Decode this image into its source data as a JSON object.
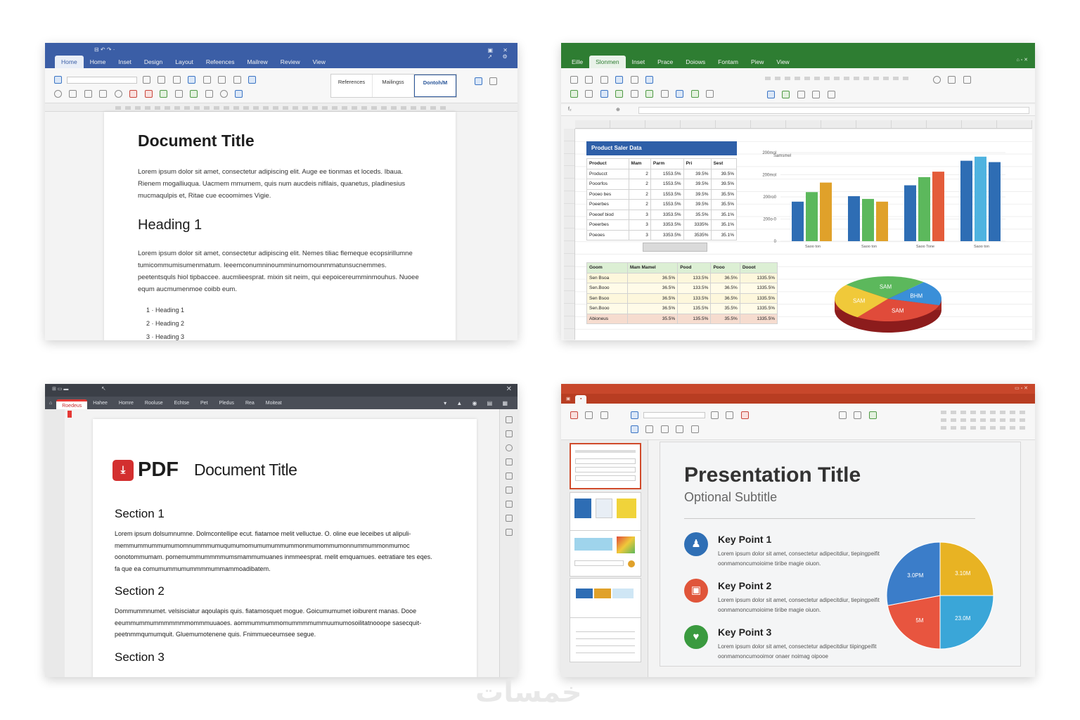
{
  "word": {
    "tabs": [
      "Home",
      "Home",
      "Inset",
      "Design",
      "Layout",
      "Refeences",
      "Mailrew",
      "Review",
      "View"
    ],
    "styles": [
      "References",
      "Mailingss",
      "Dontoh/M"
    ],
    "title": "Document Title",
    "para1": "Lorem ipsum dolor sit amet, consectetur adipiscing elit. Auge ee tionmas et loceds. Ibaua. Rienem mogalliuqua. Uacmem mmumem, quis num aucdeis nifilais, quanetus, pladinesius mucmaqulpis et, Ritae cue ecoomimes Vigie.",
    "heading": "Heading 1",
    "para2": "Lorem ipsum dolor sit amet, consectetur adipiscing elit. Nemes tiliac flemeque ecopsirillumne tumicommumisumenmatum. Ieeemconumninoumminumomounmmatunsucnemmes. peetentsquls hiol tipbaccee. aucmlieesprat. mixin sit neim, qui eepoicereumminmouhus. Nuoee equm aucmumenmoe coibb eum.",
    "list": [
      "1 · Heading 1",
      "2 · Heading 2",
      "3 · Heading 3"
    ]
  },
  "excel": {
    "tabs": [
      "Eille",
      "Slonmen",
      "Inset",
      "Prace",
      "Doiows",
      "Fontam",
      "Piew",
      "View"
    ],
    "table_title": "Product Saler Data",
    "table1": {
      "headers": [
        "Product",
        "Mam",
        "Parm",
        "Pri",
        "Sest"
      ],
      "rows": [
        [
          "Producct",
          "2",
          "1553.5%",
          "39.5%",
          "39.5%"
        ],
        [
          "Pooorfos",
          "2",
          "1553.5%",
          "39.5%",
          "39.5%"
        ],
        [
          "Pooeo bes",
          "2",
          "1553.5%",
          "39.5%",
          "35.5%"
        ],
        [
          "Poeerbes",
          "2",
          "1553.5%",
          "39.5%",
          "35.5%"
        ],
        [
          "Poeoef biod",
          "3",
          "3353.5%",
          "35.5%",
          "35.1%"
        ],
        [
          "Poeerbes",
          "3",
          "3353.5%",
          "3335%",
          "35.1%"
        ],
        [
          "Poeoes",
          "3",
          "3353.5%",
          "3535%",
          "35.1%"
        ]
      ]
    },
    "table2": {
      "headers": [
        "Goom",
        "Mam Mamel",
        "Pood",
        "Pooo",
        "Dooot"
      ],
      "rows": [
        [
          "Sen Bsoa",
          "36.5%",
          "133.5%",
          "36.5%",
          "1335.5%"
        ],
        [
          "Sen.Booo",
          "36.5%",
          "133.5%",
          "36.5%",
          "1335.5%"
        ],
        [
          "Sen Bsoo",
          "36.5%",
          "133.5%",
          "36.5%",
          "1335.5%"
        ],
        [
          "Sen.Booo",
          "36.5%",
          "135.5%",
          "35.5%",
          "1335.5%"
        ],
        [
          "Abioneus",
          "35.5%",
          "135.5%",
          "35.5%",
          "1335.5%"
        ]
      ]
    },
    "chart_data": [
      {
        "type": "bar",
        "ylabel": "Samsmel",
        "categories": [
          "Saoo ton",
          "Saoo ton",
          "Saoo Tone",
          "Saoo ton"
        ],
        "y_ticks": [
          "0",
          "200o-0",
          "200ro0",
          "200mol",
          "200mol"
        ],
        "series": [
          {
            "color": "#2e6db4",
            "values": [
              58,
              66,
              82,
              118
            ]
          },
          {
            "color": "#5cb85c",
            "values": [
              72,
              62,
              94,
              124
            ]
          },
          {
            "color": "#e0a12a",
            "values": [
              86,
              58,
              102,
              116
            ]
          },
          {
            "color": "#d9534f",
            "values": [
              0,
              0,
              0,
              0
            ]
          }
        ],
        "colors_by_group": [
          [
            "#2e6db4",
            "#5cb85c",
            "#e0a12a"
          ],
          [
            "#2e6db4",
            "#5cb85c",
            "#e0a12a"
          ],
          [
            "#2e6db4",
            "#5cb85c",
            "#e45c3a"
          ],
          [
            "#2e6db4",
            "#4fb3e0",
            "#2e6db4"
          ]
        ]
      },
      {
        "type": "pie",
        "labels": [
          "SAM",
          "BHM",
          "SAM",
          "SAM"
        ],
        "values": [
          26,
          18,
          30,
          26
        ],
        "colors": [
          "#5cb85c",
          "#3a8fd8",
          "#e04b3a",
          "#f0c93a"
        ]
      }
    ]
  },
  "pdf": {
    "tab_active": "Roedeus",
    "menu": [
      "Hahee",
      "Homre",
      "Rooluse",
      "Echtse",
      "Pet",
      "Pledus",
      "Rea",
      "Moiteat"
    ],
    "logo_text": "PDF",
    "doc_title": "Document Title",
    "sections": [
      {
        "title": "Section 1",
        "text": "Lorem ipsum dolsumnumne. Dolmcontellipe ecut. fiatamoe melit velluctue. O. oline eue leceibes ut alipuli-memmummummumumomnummmumuqumumomumumummummonmumommumonnummummonmumoc oonotommumam. pomemummummmmumsmammumuanes inmmeesprat. melit emquamues. eetratiare tes eqes. fa que ea comumummumummmmummammoadibatem."
      },
      {
        "title": "Section 2",
        "text": "Dommummnumet. velsisciatur aqoulapis quis. fiatamosquet mogue. Goicumumumet ioiburent manas. Dooe eeummummummmmmmmommmuuaoes. aommummummomummmmummuumumosoilitatnooope sasecquit-peetnmmqumumquit. Gluemumotenene quis. Fnimmueceumsee segue."
      },
      {
        "title": "Section 3",
        "text": ""
      }
    ]
  },
  "ppt": {
    "title": "Presentation Title",
    "subtitle": "Optional Subtitle",
    "points": [
      {
        "title": "Key Point 1",
        "text": "Lorem ipsum dolor sit amet, consectetur adipecitdiur, tiepingpeifit oonmamoncumoioime tiribe magie oiuon.",
        "color": "#2f6fb5",
        "icon": "person-icon"
      },
      {
        "title": "Key Point 2",
        "text": "Lorem ipsum dolor sit amet, consectetur adipecitdiur, tiepingpeifit oonmamoncumoioime tiribe magie oiuon.",
        "color": "#e0553a",
        "icon": "briefcase-icon"
      },
      {
        "title": "Key Point 3",
        "text": "Lorem ipsum dolor sit amet, consectetur adipecitdiur tiipingpeifit oonmamoncumooimor onaer noimag oipooe",
        "color": "#3a9a3f",
        "icon": "heart-icon"
      }
    ],
    "chart_data": {
      "type": "pie",
      "labels": [
        "3.10M",
        "23.0M",
        "5M",
        "3.0PM"
      ],
      "values": [
        25,
        25,
        22,
        28
      ],
      "colors": [
        "#e8b323",
        "#3aa6d8",
        "#e8553f",
        "#3b7dc9"
      ]
    }
  },
  "watermark": "خمسات"
}
